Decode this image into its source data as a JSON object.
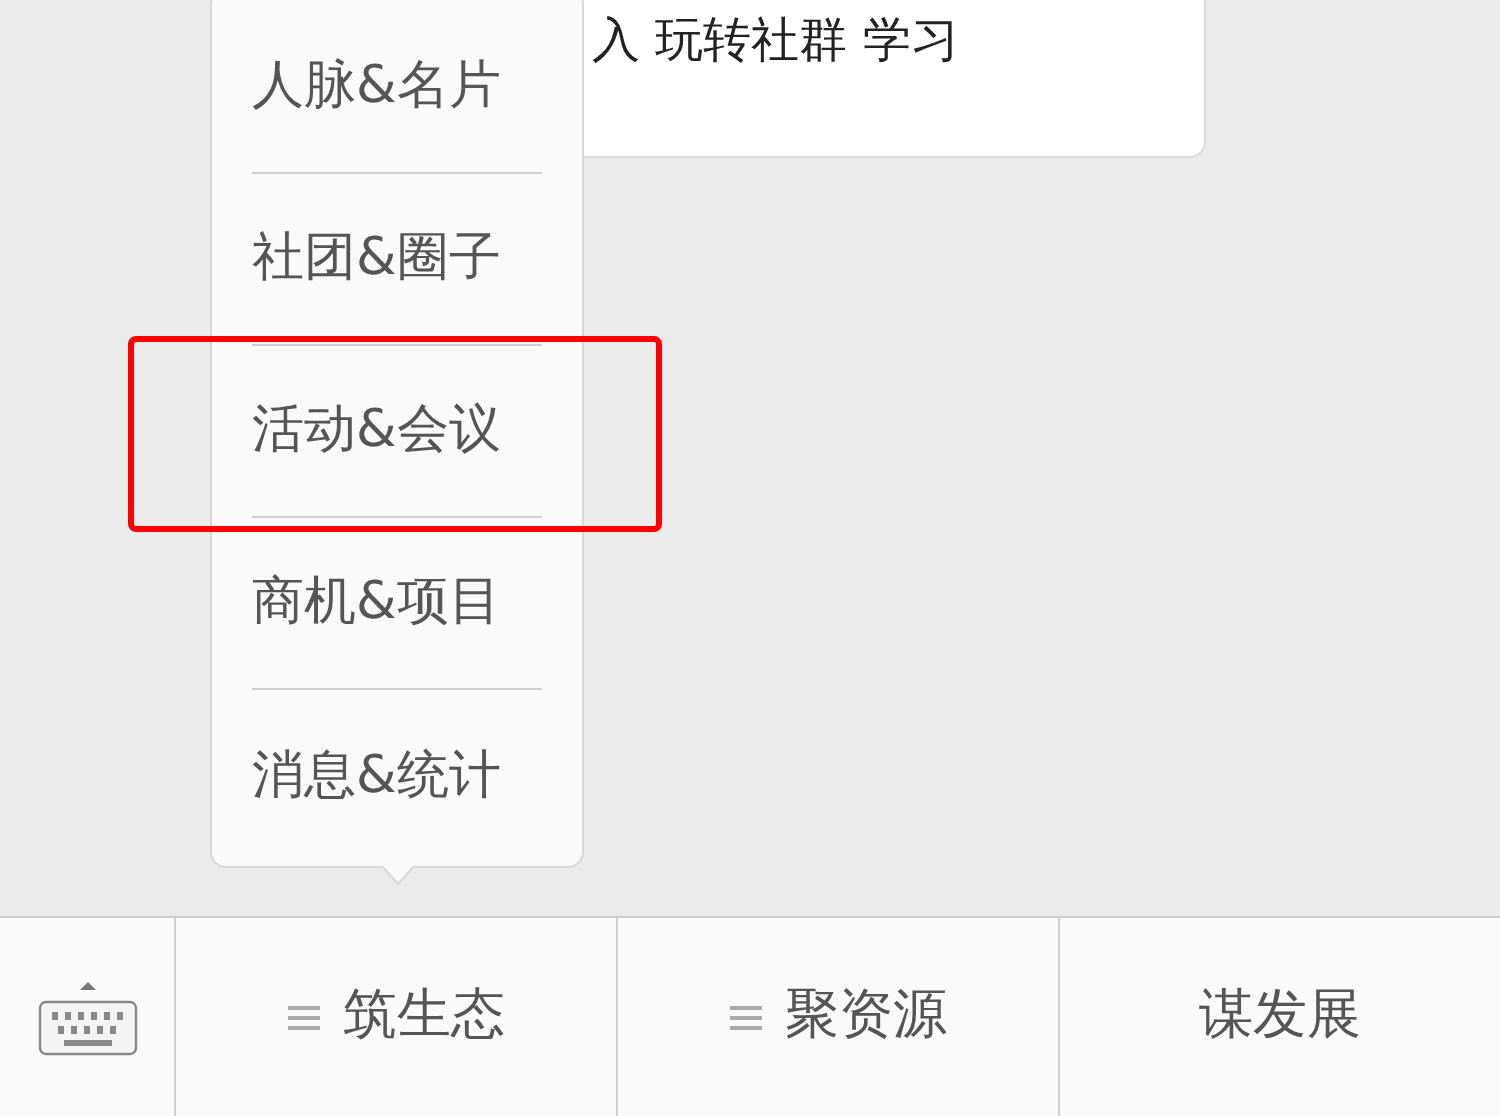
{
  "message": {
    "text": "入 玩转社群 学习"
  },
  "popup_menu": {
    "items": [
      {
        "label": "人脉&名片",
        "highlighted": false
      },
      {
        "label": "社团&圈子",
        "highlighted": false
      },
      {
        "label": "活动&会议",
        "highlighted": true
      },
      {
        "label": "商机&项目",
        "highlighted": false
      },
      {
        "label": "消息&统计",
        "highlighted": false
      }
    ]
  },
  "bottom_menu": [
    {
      "label": "筑生态",
      "has_submenu": true
    },
    {
      "label": "聚资源",
      "has_submenu": true
    },
    {
      "label": "谋发展",
      "has_submenu": false
    }
  ]
}
